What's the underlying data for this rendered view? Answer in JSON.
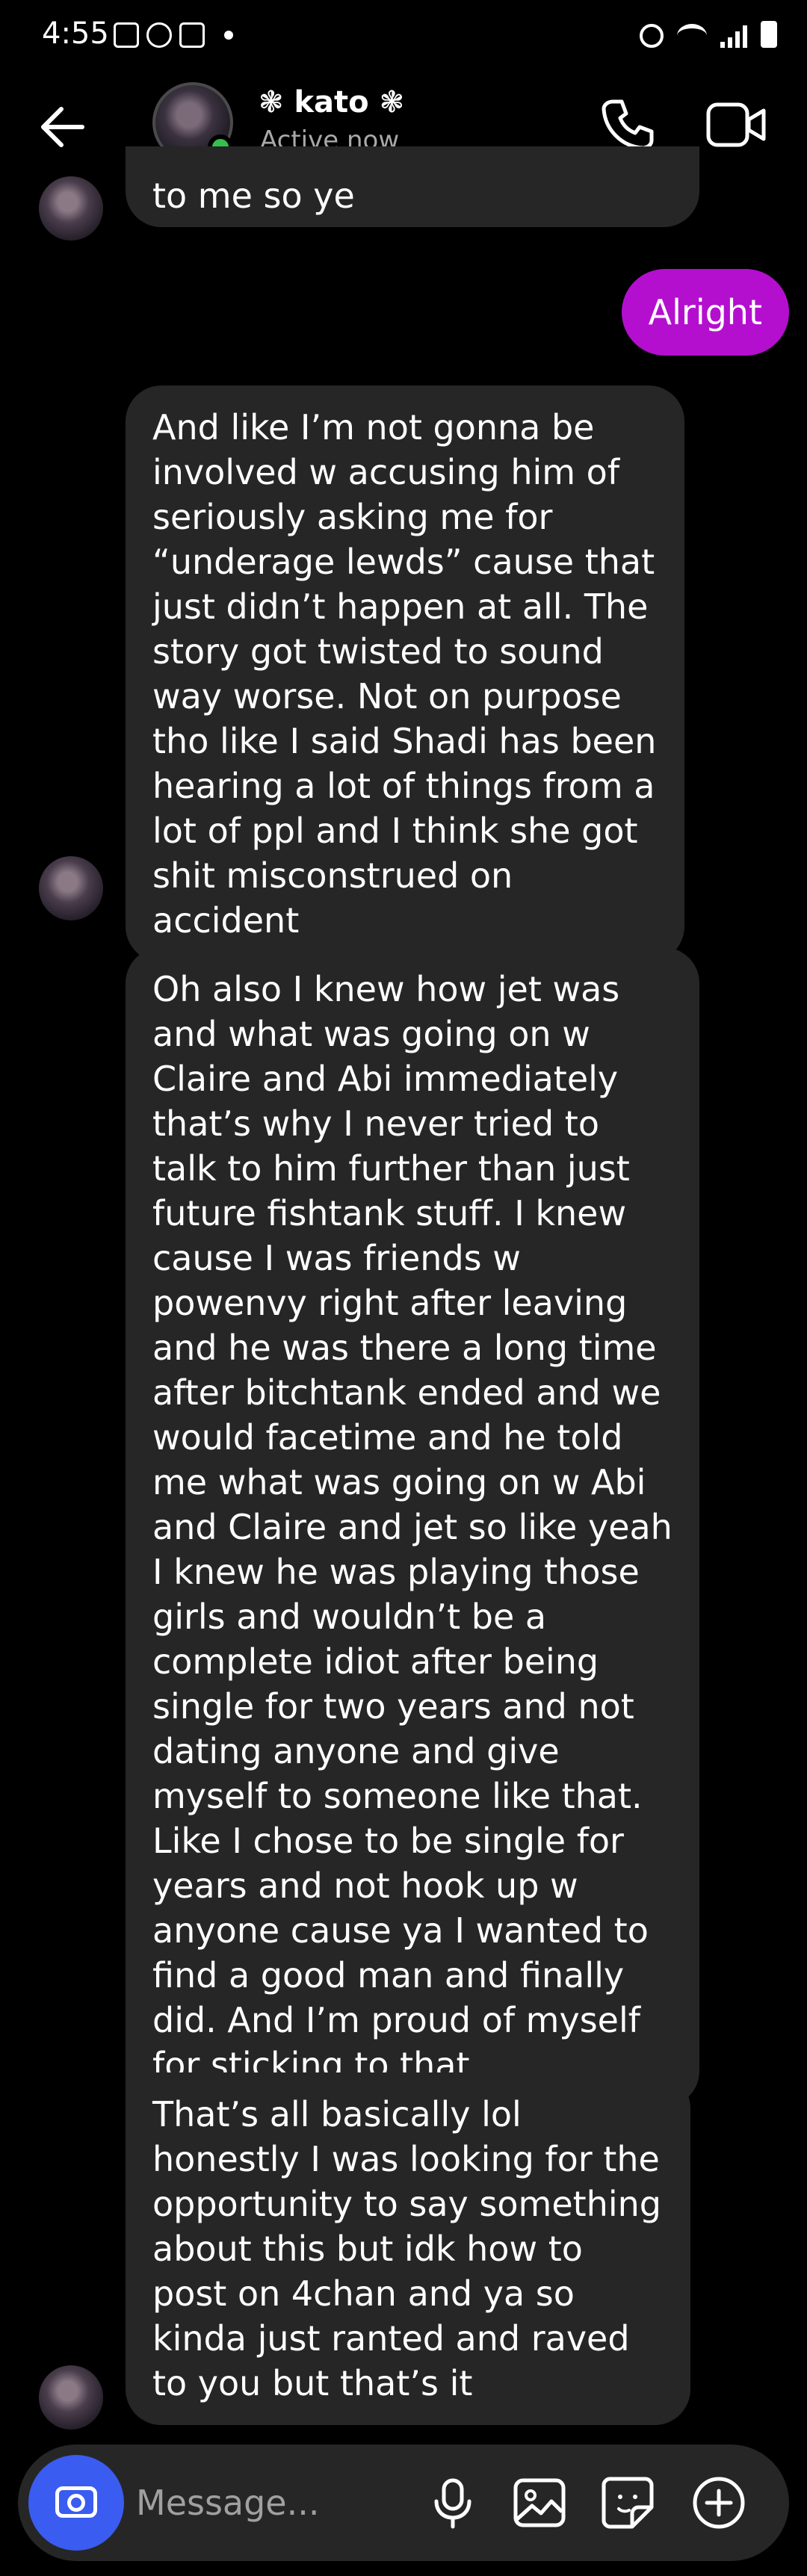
{
  "status_bar": {
    "time": "4:55"
  },
  "header": {
    "contact_name": "❃ kato ❃",
    "contact_status": "Active now",
    "back_icon": "arrow-left-icon",
    "call_icon": "phone-icon",
    "video_icon": "video-camera-icon"
  },
  "messages": [
    {
      "direction": "incoming",
      "text": "to me so ye"
    },
    {
      "direction": "outgoing",
      "text": "Alright"
    },
    {
      "direction": "incoming",
      "text": "And like I’m not gonna be involved w accusing him of seriously asking me for “underage lewds” cause that just didn’t happen at all. The story got twisted to sound way worse. Not on purpose tho like I said Shadi has been hearing a lot of things from a lot of ppl and I think she got shit misconstrued on accident"
    },
    {
      "direction": "incoming",
      "text": "Oh also I knew how jet was and what was going on w Claire and Abi immediately that’s why I never tried to talk to him further than just future fishtank stuff. I knew cause I was friends w powenvy right after leaving and he was there a long time after bitchtank ended and we would facetime and he told me what was going on w Abi and Claire and jet so like yeah I knew he was playing those girls and wouldn’t be a complete idiot after being single for two years and not dating anyone and give myself to someone like that. Like I chose to be single for years and not hook up w anyone cause ya I wanted to find a good man and finally did. And I’m proud of myself for sticking to that."
    },
    {
      "direction": "incoming",
      "text": "That’s all basically lol honestly I was looking for the opportunity to say something about this but idk how to post on 4chan and ya so kinda just ranted and raved to you but that’s it"
    }
  ],
  "composer": {
    "placeholder": "Message...",
    "icons": [
      "camera-icon",
      "microphone-icon",
      "gallery-icon",
      "sticker-icon",
      "plus-circle-icon"
    ]
  },
  "colors": {
    "background": "#000000",
    "incoming_bubble": "#262626",
    "outgoing_bubble": "#b40fcf",
    "online_indicator": "#35c04d",
    "camera_button": "#3a5cf0"
  }
}
